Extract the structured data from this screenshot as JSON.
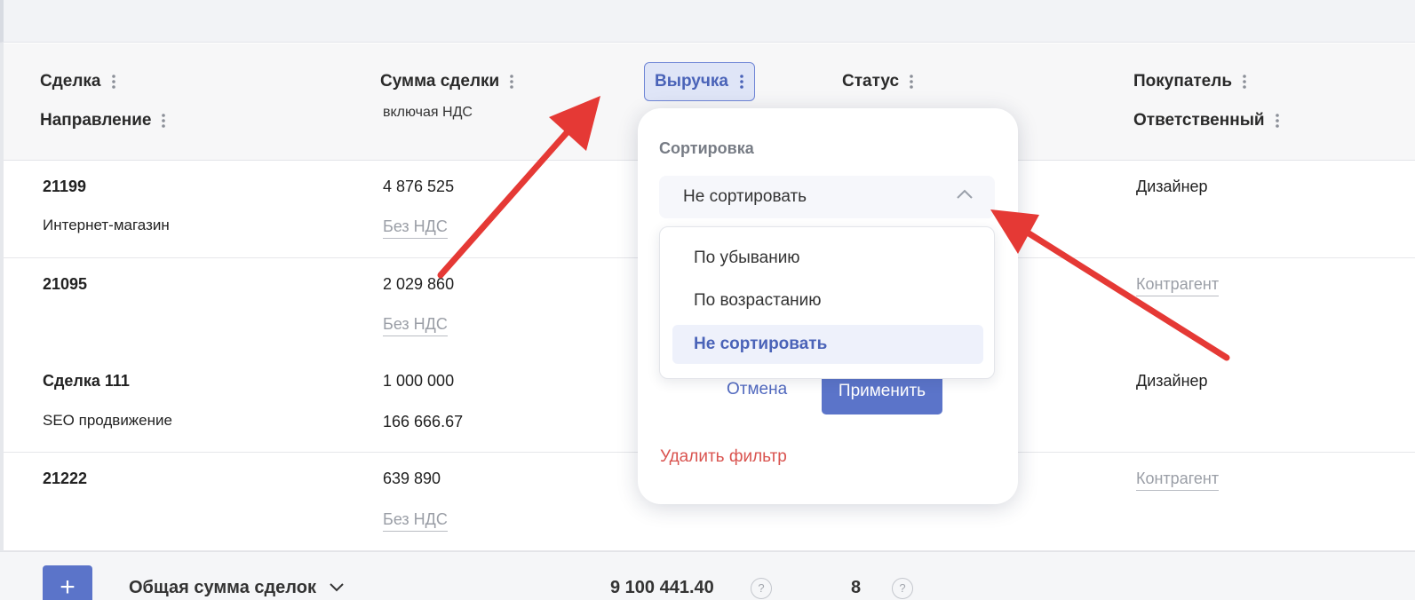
{
  "table": {
    "headers": {
      "deal": "Сделка",
      "direction": "Направление",
      "amount": "Сумма сделки",
      "amount_sub": "включая НДС",
      "revenue": "Выручка",
      "status": "Статус",
      "buyer": "Покупатель",
      "responsible": "Ответственный"
    },
    "rows": [
      {
        "deal": "21199",
        "direction": "Интернет-магазин",
        "amount": "4 876 525",
        "amount_sub": "Без НДС",
        "buyer": "Дизайнер"
      },
      {
        "deal": "21095",
        "direction": "",
        "amount": "2 029 860",
        "amount_sub": "Без НДС",
        "buyer": "Контрагент"
      },
      {
        "deal": "Сделка 111",
        "direction": "SEO продвижение",
        "amount": "1 000 000",
        "amount_sub": "166 666.67",
        "buyer": "Дизайнер"
      },
      {
        "deal": "21222",
        "direction": "",
        "amount": "639 890",
        "amount_sub": "Без НДС",
        "buyer": "Контрагент"
      }
    ]
  },
  "footer": {
    "add_label": "+",
    "total_label": "Общая сумма сделок",
    "total_value": "9 100 441.40",
    "count_value": "8",
    "help_glyph": "?"
  },
  "popup": {
    "title": "Сортировка",
    "selected": "Не сортировать",
    "options": [
      "По убыванию",
      "По возрастанию",
      "Не сортировать"
    ],
    "active_index": 2,
    "cancel": "Отмена",
    "apply": "Применить",
    "delete": "Удалить фильтр"
  },
  "colors": {
    "accent": "#5b74c9",
    "danger": "#d9534f",
    "annotation_arrow": "#e53935"
  },
  "icons": {
    "kebab": "kebab-menu-icon",
    "chevron_up": "chevron-up-icon",
    "chevron_down": "chevron-down-icon",
    "help": "help-icon"
  }
}
